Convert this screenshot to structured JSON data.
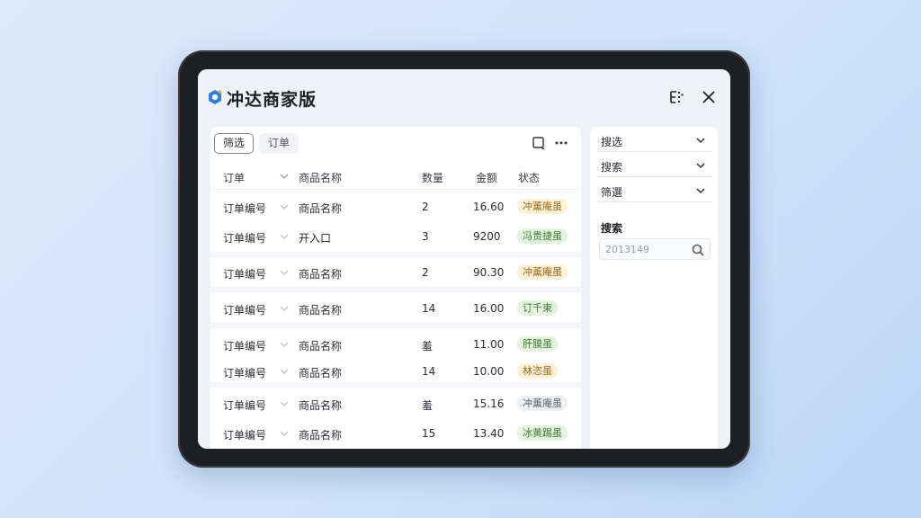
{
  "app": {
    "title": "冲达商家版"
  },
  "toolbar": {
    "filter_chip": "筛选",
    "orders_chip": "订单"
  },
  "table": {
    "headers": {
      "order": "订单",
      "product": "商品名称",
      "qty": "数量",
      "amount": "金额",
      "status": "状态"
    },
    "rows": [
      {
        "order": "订单编号",
        "product": "商品名称",
        "qty": "2",
        "amount": "16.60",
        "status": "冲薰庵虽",
        "tone": "orange"
      },
      {
        "order": "订单编号",
        "product": "开入口",
        "qty": "3",
        "amount": "9200",
        "status": "冯贵捷虽",
        "tone": "green"
      },
      {
        "order": "订单编号",
        "product": "商品名称",
        "qty": "2",
        "amount": "90.30",
        "status": "冲薰庵虽",
        "tone": "orange"
      },
      {
        "order": "订单编号",
        "product": "商品名称",
        "qty": "14",
        "amount": "16.00",
        "status": "订千束",
        "tone": "green"
      },
      {
        "order": "订单编号",
        "product": "商品名称",
        "qty": "羞",
        "amount": "11.00",
        "status": "肝膜虽",
        "tone": "green"
      },
      {
        "order": "订单编号",
        "product": "商品名称",
        "qty": "14",
        "amount": "10.00",
        "status": "林恣虽",
        "tone": "orange"
      },
      {
        "order": "订单编号",
        "product": "商品名称",
        "qty": "羞",
        "amount": "15.16",
        "status": "冲薰庵虽",
        "tone": "gray"
      },
      {
        "order": "订单编号",
        "product": "商品名称",
        "qty": "15",
        "amount": "13.40",
        "status": "冰黄踢虽",
        "tone": "green"
      }
    ]
  },
  "sidebar": {
    "dropdowns": [
      "搜选",
      "搜索",
      "筛選"
    ],
    "search_label": "搜索",
    "search_value": "2013149"
  },
  "colors": {
    "orange_bg": "#fdf0d6",
    "orange_fg": "#9a6a1c",
    "green_bg": "#e3f3dc",
    "green_fg": "#3f7a34",
    "gray_bg": "#eef0f2",
    "gray_fg": "#5e646b"
  },
  "icons": [
    "logo-icon",
    "grid-icon",
    "close-icon",
    "square-icon",
    "more-icon",
    "chevron-down-icon",
    "search-icon"
  ]
}
